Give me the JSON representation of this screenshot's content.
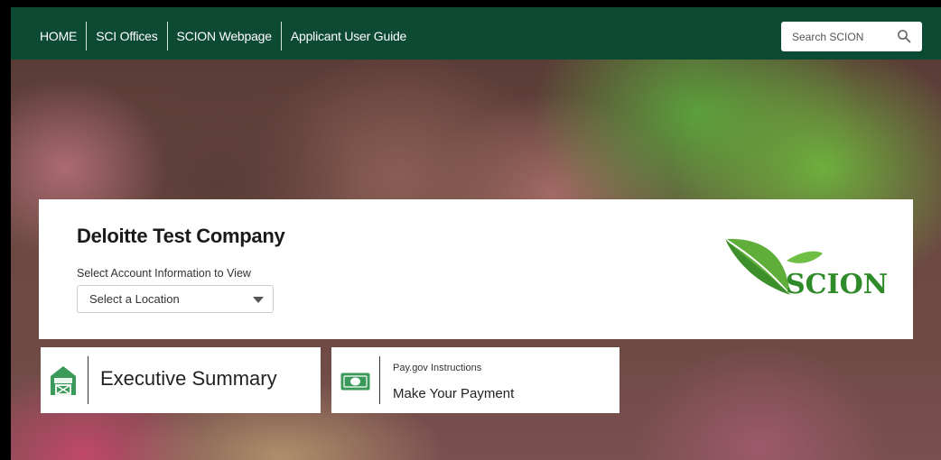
{
  "nav": {
    "items": [
      {
        "label": "HOME"
      },
      {
        "label": "SCI Offices"
      },
      {
        "label": "SCION Webpage"
      },
      {
        "label": "Applicant User Guide"
      }
    ],
    "search": {
      "placeholder": "Search SCION",
      "icon": "search-icon"
    }
  },
  "company": {
    "title": "Deloitte Test Company",
    "account_label": "Select Account Information to View",
    "location_select": {
      "selected": "Select a Location"
    },
    "logo": {
      "text": "SCION",
      "icon": "leaf-icon"
    }
  },
  "tiles": {
    "executive_summary": {
      "label": "Executive Summary",
      "icon": "barn-icon"
    },
    "payment": {
      "kicker": "Pay.gov Instructions",
      "label": "Make Your Payment",
      "icon": "money-icon"
    }
  },
  "colors": {
    "nav_bg": "#0d4a33",
    "brand_green": "#2f8a2a",
    "icon_green": "#3a9a5a"
  }
}
